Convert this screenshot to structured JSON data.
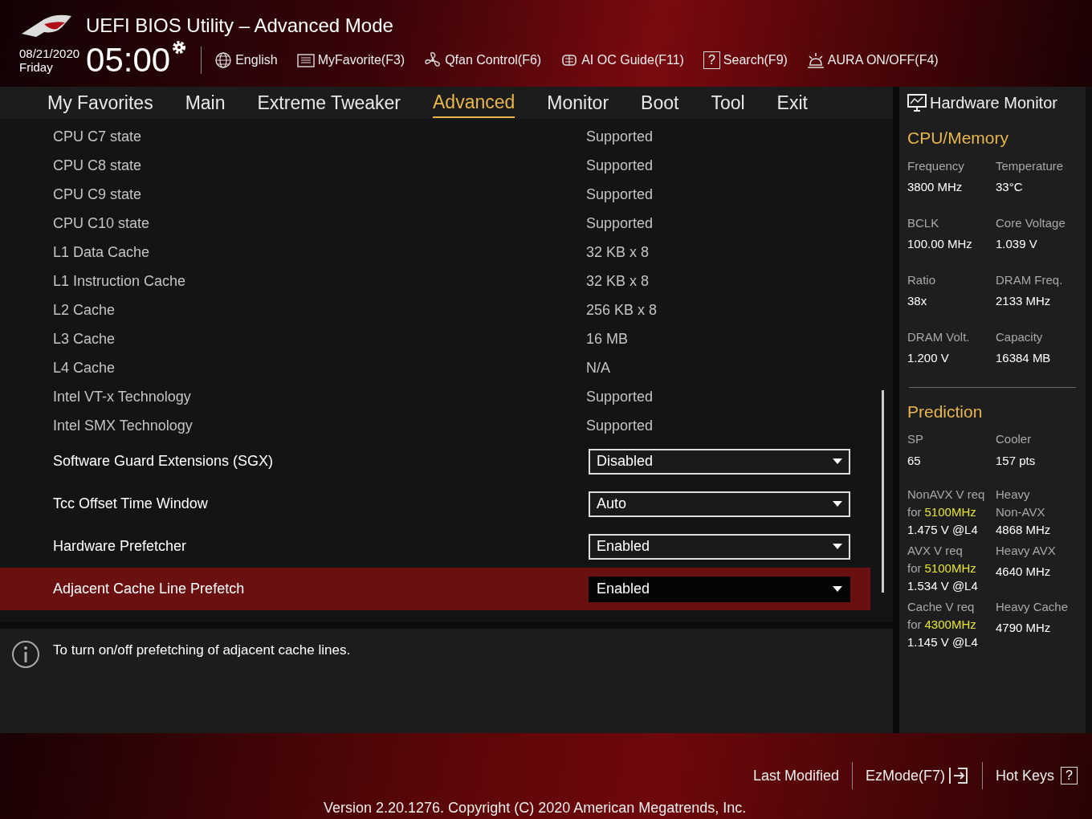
{
  "header": {
    "title": "UEFI BIOS Utility – Advanced Mode",
    "date": "08/21/2020",
    "day": "Friday",
    "time": "05:00",
    "tools": [
      {
        "kind": "globe",
        "label": "English"
      },
      {
        "kind": "favorite",
        "label": "MyFavorite(F3)"
      },
      {
        "kind": "fan",
        "label": "Qfan Control(F6)"
      },
      {
        "kind": "chip",
        "label": "AI OC Guide(F11)"
      },
      {
        "kind": "search",
        "label": "Search(F9)",
        "glyph": "?"
      },
      {
        "kind": "aura",
        "label": "AURA ON/OFF(F4)"
      }
    ]
  },
  "tabs": [
    {
      "label": "My Favorites",
      "selected": false
    },
    {
      "label": "Main",
      "selected": false
    },
    {
      "label": "Extreme Tweaker",
      "selected": false
    },
    {
      "label": "Advanced",
      "selected": true
    },
    {
      "label": "Monitor",
      "selected": false
    },
    {
      "label": "Boot",
      "selected": false
    },
    {
      "label": "Tool",
      "selected": false
    },
    {
      "label": "Exit",
      "selected": false
    }
  ],
  "settings": [
    {
      "kind": "info",
      "label": "CPU C7 state",
      "value": "Supported"
    },
    {
      "kind": "info",
      "label": "CPU C8 state",
      "value": "Supported"
    },
    {
      "kind": "info",
      "label": "CPU C9 state",
      "value": "Supported"
    },
    {
      "kind": "info",
      "label": "CPU C10 state",
      "value": "Supported"
    },
    {
      "kind": "info",
      "label": "L1 Data Cache",
      "value": "32 KB x 8"
    },
    {
      "kind": "info",
      "label": "L1 Instruction Cache",
      "value": "32 KB x 8"
    },
    {
      "kind": "info",
      "label": "L2 Cache",
      "value": "256 KB x 8"
    },
    {
      "kind": "info",
      "label": "L3 Cache",
      "value": "16 MB"
    },
    {
      "kind": "info",
      "label": "L4 Cache",
      "value": "N/A"
    },
    {
      "kind": "info",
      "label": "Intel VT-x Technology",
      "value": "Supported"
    },
    {
      "kind": "info",
      "label": "Intel SMX Technology",
      "value": "Supported"
    },
    {
      "kind": "dropdown",
      "label": "Software Guard Extensions (SGX)",
      "value": "Disabled",
      "selected": false
    },
    {
      "kind": "dropdown",
      "label": "Tcc Offset Time Window",
      "value": "Auto",
      "selected": false
    },
    {
      "kind": "dropdown",
      "label": "Hardware Prefetcher",
      "value": "Enabled",
      "selected": false
    },
    {
      "kind": "dropdown",
      "label": "Adjacent Cache Line Prefetch",
      "value": "Enabled",
      "selected": true
    }
  ],
  "help": {
    "text": "To turn on/off prefetching of adjacent cache lines."
  },
  "hardware_monitor": {
    "title": "Hardware Monitor",
    "cpu_memory": {
      "title": "CPU/Memory",
      "items": [
        {
          "label": "Frequency",
          "value": "3800 MHz"
        },
        {
          "label": "Temperature",
          "value": "33°C"
        },
        {
          "label": "BCLK",
          "value": "100.00 MHz"
        },
        {
          "label": "Core Voltage",
          "value": "1.039 V"
        },
        {
          "label": "Ratio",
          "value": "38x"
        },
        {
          "label": "DRAM Freq.",
          "value": "2133 MHz"
        },
        {
          "label": "DRAM Volt.",
          "value": "1.200 V"
        },
        {
          "label": "Capacity",
          "value": "16384 MB"
        }
      ]
    },
    "prediction": {
      "title": "Prediction",
      "sp": {
        "label": "SP",
        "value": "65"
      },
      "cooler": {
        "label": "Cooler",
        "value": "157 pts"
      },
      "rows": [
        {
          "req": "NonAVX V req",
          "for": "for",
          "target": "5100MHz",
          "req_value": "1.475 V @L4",
          "heavy_lines": [
            "Heavy",
            "Non-AVX"
          ],
          "heavy_value": "4868 MHz"
        },
        {
          "req": "AVX V req",
          "for": "for",
          "target": "5100MHz",
          "req_value": "1.534 V @L4",
          "heavy_lines": [
            "Heavy AVX"
          ],
          "heavy_value": "4640 MHz"
        },
        {
          "req": "Cache V req",
          "for": "for",
          "target": "4300MHz",
          "req_value": "1.145 V @L4",
          "heavy_lines": [
            "Heavy Cache"
          ],
          "heavy_value": "4790 MHz"
        }
      ]
    }
  },
  "footer": {
    "last_modified": "Last Modified",
    "ezmode": "EzMode(F7)",
    "hotkeys": "Hot Keys",
    "hotkeys_glyph": "?",
    "version": "Version 2.20.1276. Copyright (C) 2020 American Megatrends, Inc."
  }
}
